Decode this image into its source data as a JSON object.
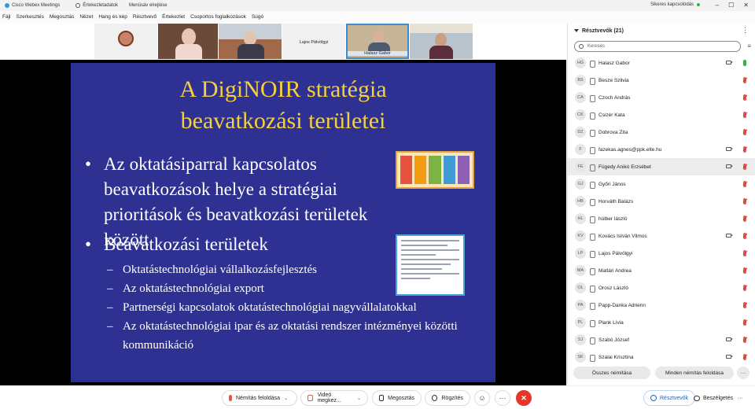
{
  "titlebar": {
    "app": "Cisco Webex Meetings",
    "info": "Értekezletadatok",
    "hide_menu": "Menüsáv elrejtése",
    "connection": "Sikeres kapcsolódás",
    "minimize": "–",
    "maximize": "☐",
    "close": "✕"
  },
  "menu": [
    "Fájl",
    "Szerkesztés",
    "Megosztás",
    "Nézet",
    "Hang és kép",
    "Résztvevő",
    "Értekezlet",
    "Csoportos foglalkozások",
    "Súgó"
  ],
  "strip": {
    "names": [
      "Lajos Pálvölgyi",
      "Halasz Gabor"
    ]
  },
  "slide": {
    "title_line1": "A DigiNOIR stratégia",
    "title_line2": "beavatkozási területei",
    "bullet_symbol": "•",
    "bullet1": "Az oktatásiparral kapcsolatos beavatkozások helye a stratégiai prioritások és beavatkozási területek között",
    "bullet2": "Beavatkozási területek",
    "subs": [
      "Oktatástechnológiai vállalkozásfejlesztés",
      "Az oktatástechnológiai export",
      "Partnerségi kapcsolatok oktatástechnológiai nagyvállalatokkal",
      "Az oktatástechnológiai ipar és az oktatási rendszer intézményei közötti kommunikáció"
    ]
  },
  "participants": {
    "header": "Résztvevők (21)",
    "more": "⋮",
    "search_placeholder": "Keresés",
    "sort_icon": "sort-icon",
    "list": [
      {
        "initials": "HG",
        "name": "Halasz Gabor",
        "camera": true,
        "mic": "on"
      },
      {
        "initials": "BS",
        "name": "Besze Szilvia",
        "camera": false,
        "mic": "muted"
      },
      {
        "initials": "CA",
        "name": "Czoch András",
        "camera": false,
        "mic": "muted"
      },
      {
        "initials": "CK",
        "name": "Csizér Kata",
        "camera": false,
        "mic": "muted"
      },
      {
        "initials": "DZ",
        "name": "Dobrova Zita",
        "camera": false,
        "mic": "muted"
      },
      {
        "initials": "F",
        "name": "fazekas.agnes@ppk.elte.hu",
        "camera": true,
        "mic": "muted"
      },
      {
        "initials": "FE",
        "name": "Fügedy Anikó Erzsébet",
        "camera": true,
        "mic": "muted",
        "selected": true
      },
      {
        "initials": "GJ",
        "name": "Győri János",
        "camera": false,
        "mic": "muted"
      },
      {
        "initials": "HB",
        "name": "Horváth Balázs",
        "camera": false,
        "mic": "muted"
      },
      {
        "initials": "HL",
        "name": "hülber lászló",
        "camera": false,
        "mic": "muted"
      },
      {
        "initials": "KV",
        "name": "Kovács István Vilmos",
        "camera": true,
        "mic": "muted"
      },
      {
        "initials": "LP",
        "name": "Lajos Pálvölgyi",
        "camera": false,
        "mic": "muted"
      },
      {
        "initials": "MA",
        "name": "Matlári Andrea",
        "camera": false,
        "mic": "muted"
      },
      {
        "initials": "OL",
        "name": "Orosz László",
        "camera": false,
        "mic": "muted"
      },
      {
        "initials": "PA",
        "name": "Papp-Danka Adrienn",
        "camera": false,
        "mic": "muted"
      },
      {
        "initials": "PL",
        "name": "Plank Lívia",
        "camera": false,
        "mic": "muted"
      },
      {
        "initials": "SJ",
        "name": "Szabó József",
        "camera": true,
        "mic": "muted"
      },
      {
        "initials": "SK",
        "name": "Szalai Krisztina",
        "camera": true,
        "mic": "muted"
      }
    ],
    "mute_all": "Összes némítása",
    "unmute_all": "Minden némítás feloldása",
    "footer_more": "···"
  },
  "toolbar": {
    "unmute": "Némítás feloldása",
    "video": "Videó megkez...",
    "share": "Megosztás",
    "record": "Rögzítés",
    "reactions_glyph": "☺",
    "more_glyph": "···",
    "leave_glyph": "✕",
    "participants": "Résztvevők",
    "chat": "Beszélgetés",
    "right_more": "···",
    "caret": "⌄"
  },
  "colors": {
    "slide_bg": "#2e3192",
    "slide_title": "#f4d03f",
    "accent_blue": "#1a64c8",
    "muted_red": "#e35a4e",
    "leave_red": "#e5372b",
    "status_green": "#2eb34a"
  }
}
